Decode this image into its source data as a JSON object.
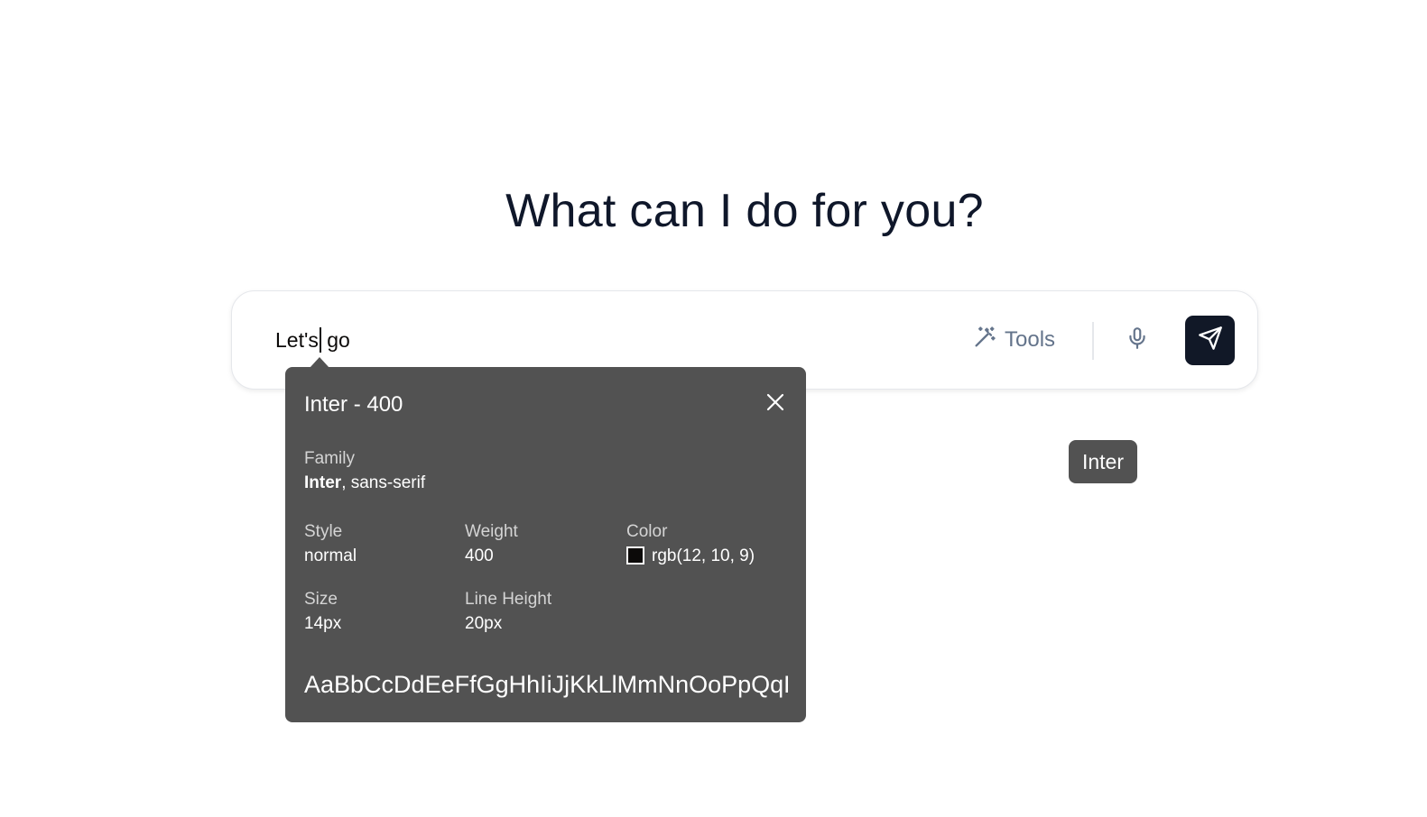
{
  "main": {
    "heading": "What can I do for you?"
  },
  "composer": {
    "input_value_before_caret": "Let's",
    "input_value_after_caret": " go",
    "tools_label": "Tools",
    "tools_icon": "wand-sparkles-icon",
    "mic_icon": "microphone-icon",
    "send_icon": "send-icon"
  },
  "font_inspector": {
    "title": "Inter - 400",
    "family_label": "Family",
    "family_primary": "Inter",
    "family_fallback": ", sans-serif",
    "style_label": "Style",
    "style_value": "normal",
    "weight_label": "Weight",
    "weight_value": "400",
    "color_label": "Color",
    "color_value": "rgb(12, 10, 9)",
    "color_hex": "#0c0a09",
    "size_label": "Size",
    "size_value": "14px",
    "line_height_label": "Line Height",
    "line_height_value": "20px",
    "sample": "AaBbCcDdEeFfGgHhIiJjKkLlMmNnOoPpQqRrSsTtUuVvWwXxYyZz"
  },
  "font_chip": {
    "label": "Inter"
  },
  "colors": {
    "heading": "#0f172a",
    "send_button_bg": "#111827",
    "tooltip_bg": "#525252",
    "tools_text": "#64748b"
  }
}
